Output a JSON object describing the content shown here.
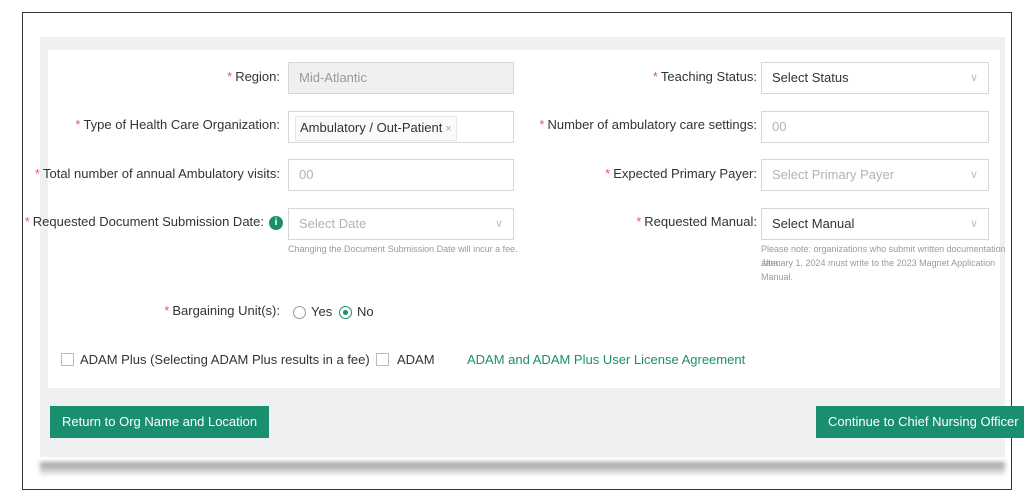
{
  "form": {
    "region": {
      "label": "Region:",
      "value": "Mid-Atlantic"
    },
    "teaching_status": {
      "label": "Teaching Status:",
      "value": "Select Status"
    },
    "org_type": {
      "label": "Type of Health Care Organization:",
      "tag": "Ambulatory / Out-Patient"
    },
    "ambulatory_settings": {
      "label": "Number of ambulatory care settings:",
      "placeholder": "00"
    },
    "annual_visits": {
      "label": "Total number of annual Ambulatory visits:",
      "placeholder": "00"
    },
    "primary_payer": {
      "label": "Expected Primary Payer:",
      "placeholder": "Select Primary Payer"
    },
    "submission_date": {
      "label": "Requested Document Submission Date:",
      "placeholder": "Select Date",
      "hint": "Changing the Document Submission Date will incur a fee."
    },
    "manual": {
      "label": "Requested Manual:",
      "value": "Select Manual",
      "note_line1": "Please note: organizations who submit written documentation after",
      "note_line2": "January 1, 2024 must write to the 2023 Magnet Application",
      "note_line3": "Manual."
    },
    "bargaining": {
      "label": "Bargaining Unit(s):",
      "options": [
        "Yes",
        "No"
      ],
      "selected": "No"
    },
    "adam_plus_label": "ADAM Plus (Selecting ADAM Plus results in a fee)",
    "adam_label": "ADAM",
    "license_link": "ADAM and ADAM Plus User License Agreement"
  },
  "buttons": {
    "back": "Return to Org Name and Location",
    "continue": "Continue to Chief Nursing Officer"
  },
  "colors": {
    "accent": "#1a8f6f",
    "required": "#e8545f"
  }
}
